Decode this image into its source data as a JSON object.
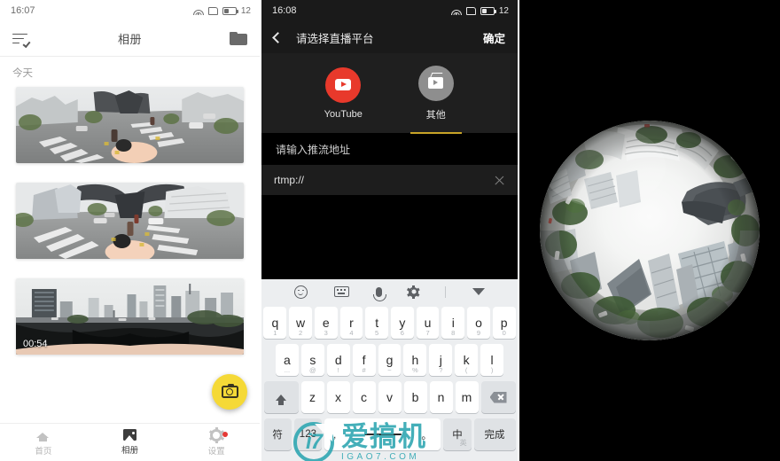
{
  "album_panel": {
    "statusbar": {
      "time": "16:07",
      "battery": "12",
      "wifi_icon": "wifi-icon",
      "sim_icon": "sim-card-icon",
      "battery_icon": "battery-icon"
    },
    "topbar": {
      "menu_icon": "list-check-icon",
      "title": "相册",
      "folder_icon": "folder-icon"
    },
    "section_label": "今天",
    "items": [
      {
        "name": "thumbnail-360-crosswalk",
        "duration": ""
      },
      {
        "name": "thumbnail-360-street",
        "duration": ""
      },
      {
        "name": "thumbnail-360-cityscape",
        "duration": "00:54"
      }
    ],
    "fab": {
      "icon": "camera-icon",
      "color": "#f5d937"
    },
    "tabs": [
      {
        "label": "首页",
        "icon": "home-icon",
        "active": false
      },
      {
        "label": "相册",
        "icon": "photo-icon",
        "active": true
      },
      {
        "label": "设置",
        "icon": "gear-icon",
        "active": false,
        "badge": true
      }
    ]
  },
  "live_panel": {
    "statusbar": {
      "time": "16:08",
      "battery": "12"
    },
    "topbar": {
      "back_icon": "back-arrow-icon",
      "title": "请选择直播平台",
      "confirm_label": "确定"
    },
    "platforms": [
      {
        "label": "YouTube",
        "icon": "youtube-icon",
        "color": "#e8392b",
        "selected": false
      },
      {
        "label": "其他",
        "icon": "tv-icon",
        "color": "#8e8e8e",
        "selected": true
      }
    ],
    "url_label": "请输入推流地址",
    "url_value": "rtmp://",
    "url_placeholder": "rtmp://",
    "clear_icon": "clear-x-icon"
  },
  "keyboard": {
    "toolbar": [
      {
        "name": "emoji-icon"
      },
      {
        "name": "keyboard-icon"
      },
      {
        "name": "microphone-icon"
      },
      {
        "name": "settings-gear-icon"
      },
      {
        "name": "collapse-keyboard-icon"
      }
    ],
    "row1": [
      {
        "key": "q",
        "hint": "1"
      },
      {
        "key": "w",
        "hint": "2"
      },
      {
        "key": "e",
        "hint": "3"
      },
      {
        "key": "r",
        "hint": "4"
      },
      {
        "key": "t",
        "hint": "5"
      },
      {
        "key": "y",
        "hint": "6"
      },
      {
        "key": "u",
        "hint": "7"
      },
      {
        "key": "i",
        "hint": "8"
      },
      {
        "key": "o",
        "hint": "9"
      },
      {
        "key": "p",
        "hint": "0"
      }
    ],
    "row2": [
      {
        "key": "a",
        "hint": "..."
      },
      {
        "key": "s",
        "hint": "@"
      },
      {
        "key": "d",
        "hint": "!"
      },
      {
        "key": "f",
        "hint": "#"
      },
      {
        "key": "g",
        "hint": "~"
      },
      {
        "key": "h",
        "hint": "%"
      },
      {
        "key": "j",
        "hint": "?"
      },
      {
        "key": "k",
        "hint": "("
      },
      {
        "key": "l",
        "hint": ")"
      }
    ],
    "row3": [
      {
        "key": "z",
        "hint": ""
      },
      {
        "key": "x",
        "hint": ""
      },
      {
        "key": "c",
        "hint": ""
      },
      {
        "key": "v",
        "hint": ""
      },
      {
        "key": "b",
        "hint": ""
      },
      {
        "key": "n",
        "hint": ""
      },
      {
        "key": "m",
        "hint": ""
      }
    ],
    "shift_icon": "shift-icon",
    "backspace_icon": "backspace-icon",
    "row4": {
      "symbol_label": "符",
      "numeric_label": "123",
      "space_left": ",",
      "space_right": "。",
      "lang_main": "中",
      "lang_sub": "英",
      "done_label": "完成"
    }
  },
  "watermark": {
    "logo_text": "i7",
    "cn": "爱搞机",
    "en": "IGAO7.COM",
    "color": "#36a9b4"
  },
  "viewer_panel": {
    "name": "tiny-planet-360-view",
    "background": "#000000"
  }
}
